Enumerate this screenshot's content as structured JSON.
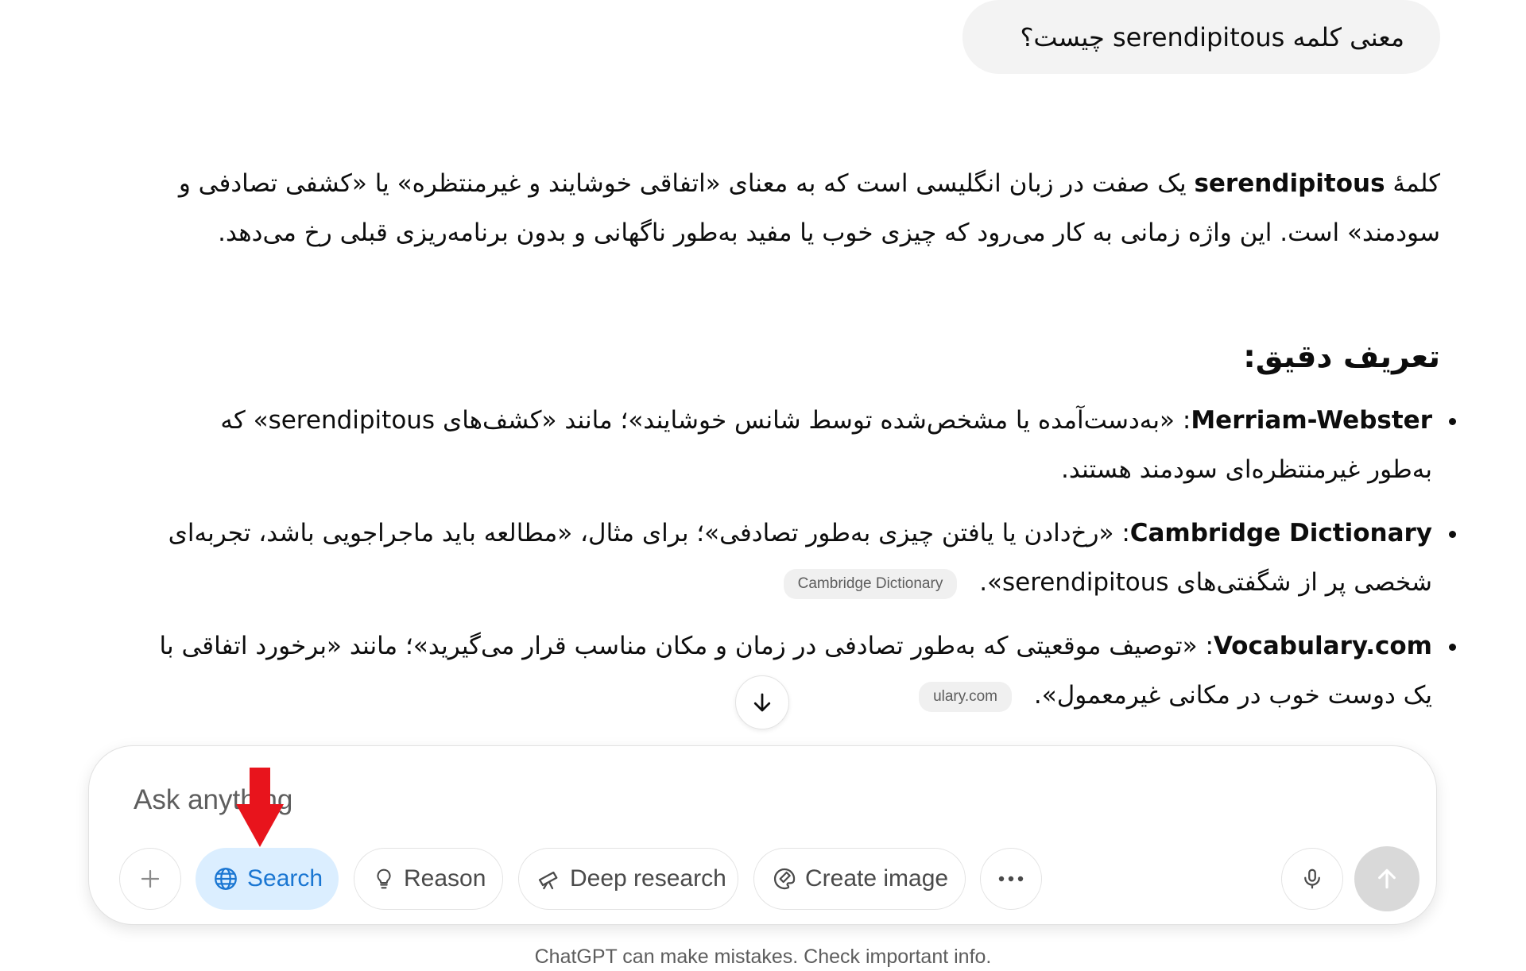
{
  "conversation": {
    "user_message": "معنی کلمه serendipitous چیست؟",
    "answer": {
      "para_prefix": "کلمهٔ ",
      "para_term": "serendipitous",
      "para_rest": " یک صفت در زبان انگلیسی است که به معنای «اتفاقی خوشایند و غیرمنتظره» یا «کشفی تصادفی و سودمند» است. این واژه زمانی به کار می‌رود که چیزی خوب یا مفید به‌طور ناگهانی و بدون برنامه‌ریزی قبلی رخ می‌دهد.",
      "heading": "تعریف دقیق:",
      "bullets": [
        {
          "source": "Merriam-Webster",
          "text": ": «به‌دست‌آمده یا مشخص‌شده توسط شانس خوشایند»؛ مانند «کشف‌های serendipitous» که به‌طور غیرمنتظره‌ای سودمند هستند.",
          "citation": ""
        },
        {
          "source": "Cambridge Dictionary",
          "text": ": «رخ‌دادن یا یافتن چیزی به‌طور تصادفی»؛ برای مثال، «مطالعه باید ماجراجویی باشد، تجربه‌ای شخصی پر از شگفتی‌های serendipitous».",
          "citation": "Cambridge Dictionary"
        },
        {
          "source": "Vocabulary.com",
          "text": ": «توصیف موقعیتی که به‌طور تصادفی در زمان و مکان مناسب قرار می‌گیرید»؛ مانند «برخورد اتفاقی با یک دوست خوب در مکانی غیرمعمول».",
          "citation": "ulary.com"
        }
      ]
    }
  },
  "composer": {
    "placeholder": "Ask anything",
    "buttons": {
      "search": "Search",
      "reason": "Reason",
      "deep_research": "Deep research",
      "create_image": "Create image"
    }
  },
  "footer": "ChatGPT can make mistakes. Check important info.",
  "annotation": {
    "arrow_color": "#e8141c"
  },
  "colors": {
    "search_active_bg": "#dbeeff",
    "search_active_fg": "#1a76d2"
  }
}
